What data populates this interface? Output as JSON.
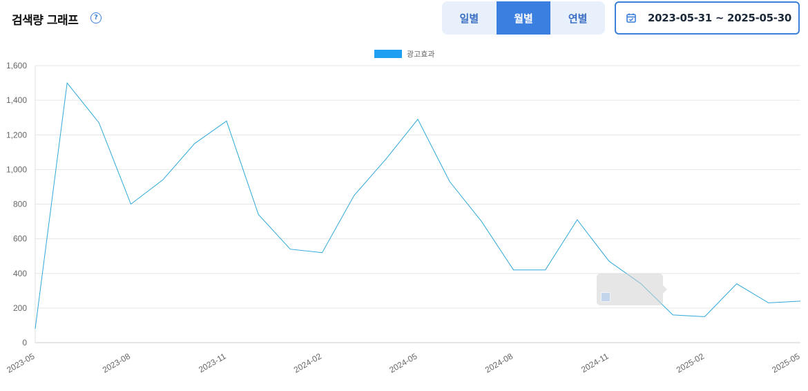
{
  "header": {
    "title": "검색량 그래프",
    "help_glyph": "?",
    "period_options": [
      {
        "label": "일별",
        "active": false
      },
      {
        "label": "월별",
        "active": true
      },
      {
        "label": "연별",
        "active": false
      }
    ],
    "date_range": "2023-05-31 ~ 2025-05-30"
  },
  "colors": {
    "accent": "#3b7fe0",
    "series_line": "#2fa8d8",
    "legend_swatch": "#1e9ff2",
    "grid": "#e6e6e6"
  },
  "chart_data": {
    "type": "line",
    "x": [
      "2023-05",
      "2023-06",
      "2023-07",
      "2023-08",
      "2023-09",
      "2023-10",
      "2023-11",
      "2023-12",
      "2024-01",
      "2024-02",
      "2024-03",
      "2024-04",
      "2024-05",
      "2024-06",
      "2024-07",
      "2024-08",
      "2024-09",
      "2024-10",
      "2024-11",
      "2024-12",
      "2025-01",
      "2025-02",
      "2025-03",
      "2025-04",
      "2025-05"
    ],
    "series": [
      {
        "name": "광고효과",
        "values": [
          80,
          1500,
          1270,
          800,
          940,
          1150,
          1280,
          740,
          540,
          520,
          850,
          1060,
          1290,
          930,
          700,
          420,
          420,
          710,
          470,
          340,
          160,
          150,
          340,
          230,
          240
        ]
      }
    ],
    "x_tick_labels": [
      "2023-05",
      "2023-08",
      "2023-11",
      "2024-02",
      "2024-05",
      "2024-08",
      "2024-11",
      "2025-02",
      "2025-05"
    ],
    "y_tick_labels": [
      "0",
      "200",
      "400",
      "600",
      "800",
      "1,000",
      "1,200",
      "1,400",
      "1,600"
    ],
    "ylim": [
      0,
      1600
    ],
    "legend_position": "top-center",
    "grid": true
  }
}
